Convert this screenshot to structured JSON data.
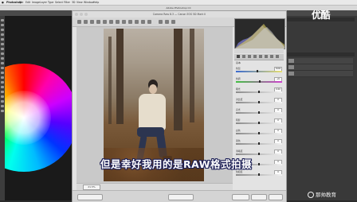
{
  "menubar": {
    "items": [
      "Photoshop",
      "File",
      "Edit",
      "Image",
      "Layer",
      "Type",
      "Select",
      "Filter",
      "3D",
      "View",
      "Window",
      "Help"
    ]
  },
  "photoshop": {
    "app_title": "Adobe Photoshop CC"
  },
  "logo": {
    "text": "优酷"
  },
  "acr": {
    "title": "Camera Raw 8.3 — Canon EOS 5D Mark II",
    "zoom": "21.5%",
    "panel_label": "基本",
    "sliders": [
      {
        "label": "色温",
        "value": "5200",
        "knob": 0.47,
        "track": "temp"
      },
      {
        "label": "色调",
        "value": "+6",
        "knob": 0.52,
        "track": "tint"
      },
      {
        "label": "曝光",
        "value": "0.00",
        "knob": 0.5,
        "track": "gray"
      },
      {
        "label": "对比度",
        "value": "0",
        "knob": 0.5,
        "track": "gray"
      },
      {
        "label": "高光",
        "value": "0",
        "knob": 0.5,
        "track": "gray"
      },
      {
        "label": "阴影",
        "value": "0",
        "knob": 0.5,
        "track": "gray"
      },
      {
        "label": "白色",
        "value": "0",
        "knob": 0.5,
        "track": "gray"
      },
      {
        "label": "黑色",
        "value": "0",
        "knob": 0.5,
        "track": "gray"
      },
      {
        "label": "清晰度",
        "value": "0",
        "knob": 0.5,
        "track": "gray"
      },
      {
        "label": "自然饱和度",
        "value": "0",
        "knob": 0.5,
        "track": "gray"
      },
      {
        "label": "饱和度",
        "value": "0",
        "knob": 0.5,
        "track": "gray"
      }
    ]
  },
  "subtitle": {
    "text": "但是幸好我用的是RAW格式拍摄"
  },
  "watermark": {
    "text": "那帅教育"
  },
  "colors": {
    "subtitle_outline": "#1a1d55",
    "dialog_bg": "#e3e3e3",
    "ps_dark": "#393939"
  }
}
